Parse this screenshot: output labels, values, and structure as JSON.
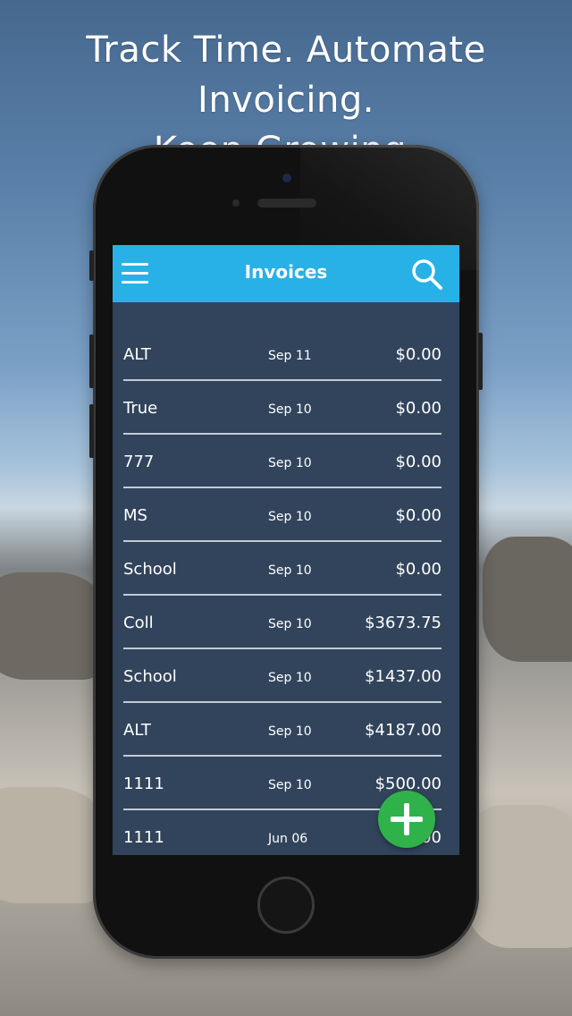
{
  "headline": {
    "line1": "Track Time. Automate Invoicing.",
    "line2": "Keep Growing."
  },
  "app": {
    "title": "Invoices",
    "accent_color": "#27b1e6",
    "list_bg_color": "#31445b",
    "fab_color": "#2fb24a",
    "icons": {
      "menu": "hamburger-menu-icon",
      "search": "search-icon",
      "add": "plus-icon"
    }
  },
  "invoices": [
    {
      "client": "ALT",
      "date": "Sep 11",
      "amount": "$0.00"
    },
    {
      "client": "True",
      "date": "Sep 10",
      "amount": "$0.00"
    },
    {
      "client": "777",
      "date": "Sep 10",
      "amount": "$0.00"
    },
    {
      "client": "MS",
      "date": "Sep 10",
      "amount": "$0.00"
    },
    {
      "client": "School",
      "date": "Sep 10",
      "amount": "$0.00"
    },
    {
      "client": "Coll",
      "date": "Sep 10",
      "amount": "$3673.75"
    },
    {
      "client": "School",
      "date": "Sep 10",
      "amount": "$1437.00"
    },
    {
      "client": "ALT",
      "date": "Sep 10",
      "amount": "$4187.00"
    },
    {
      "client": "1111",
      "date": "Sep 10",
      "amount": "$500.00"
    },
    {
      "client": "1111",
      "date": "Jun 06",
      "amount": "$1..00"
    }
  ]
}
